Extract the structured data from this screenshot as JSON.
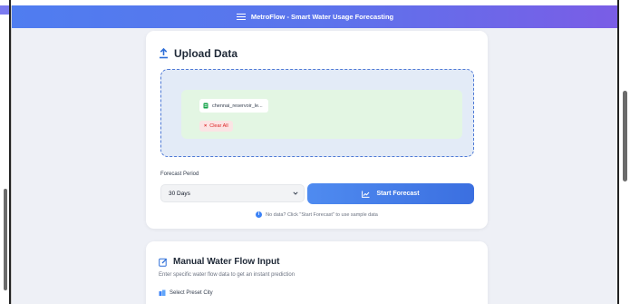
{
  "app": {
    "title": "MetroFlow - Smart Water Usage Forecasting"
  },
  "upload": {
    "title": "Upload Data",
    "file_name": "chennai_reservoir_le...",
    "clear_label": "Clear All",
    "forecast_period_label": "Forecast Period",
    "forecast_period_value": "30 Days",
    "start_label": "Start Forecast",
    "hint": "No data? Click \"Start Forecast\" to use sample data"
  },
  "manual": {
    "title": "Manual Water Flow Input",
    "subtitle": "Enter specific water flow data to get an instant prediction",
    "preset_label": "Select Preset City"
  },
  "colors": {
    "header_start": "#4f7df0",
    "header_end": "#7a5de6",
    "primary": "#3b6fe0",
    "dropzone_bg": "#e3ebf7",
    "file_bg": "#e3f6e3",
    "danger": "#dc2626"
  },
  "icons": {
    "menu": "menu-icon",
    "upload": "upload-icon",
    "file": "file-icon",
    "clear": "close-icon",
    "chevron": "chevron-down-icon",
    "chart": "chart-line-icon",
    "info": "info-icon",
    "edit": "edit-icon",
    "city": "city-icon"
  }
}
